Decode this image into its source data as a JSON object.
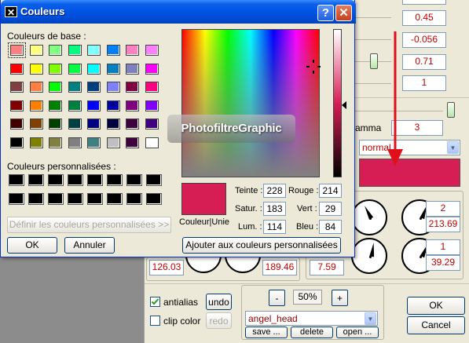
{
  "dialog": {
    "title": "Couleurs",
    "help_glyph": "?",
    "close_glyph": "✕",
    "base_colors_label": "Couleurs de base :",
    "custom_colors_label": "Couleurs personnalisées :",
    "define_custom_button": "Définir les couleurs personnalisées >>",
    "ok_button": "OK",
    "cancel_button": "Annuler",
    "add_custom_button": "Ajouter aux couleurs personnalisées",
    "color_solid_label": "Couleur|Unie",
    "watermark": "PhotofiltreGraphic",
    "fields": {
      "teinte_label": "Teinte :",
      "teinte": "228",
      "satur_label": "Satur. :",
      "satur": "183",
      "lum_label": "Lum. :",
      "lum": "114",
      "rouge_label": "Rouge :",
      "rouge": "214",
      "vert_label": "Vert :",
      "vert": "29",
      "bleu_label": "Bleu :",
      "bleu": "84"
    },
    "current_color": "#d61e54",
    "base_colors": [
      [
        "#ff8080",
        "#ffff80",
        "#80ff80",
        "#00ff80",
        "#80ffff",
        "#0080ff",
        "#ff80c0",
        "#ff80ff"
      ],
      [
        "#ff0000",
        "#ffff00",
        "#80ff00",
        "#00ff40",
        "#00ffff",
        "#0080c0",
        "#8080c0",
        "#ff00ff"
      ],
      [
        "#804040",
        "#ff8040",
        "#00ff00",
        "#008080",
        "#004080",
        "#8080ff",
        "#800040",
        "#ff0080"
      ],
      [
        "#800000",
        "#ff8000",
        "#008000",
        "#008040",
        "#0000ff",
        "#0000a0",
        "#800080",
        "#8000ff"
      ],
      [
        "#400000",
        "#804000",
        "#004000",
        "#004040",
        "#000080",
        "#000040",
        "#400040",
        "#400080"
      ],
      [
        "#000000",
        "#808000",
        "#808040",
        "#808080",
        "#408080",
        "#c0c0c0",
        "#400040",
        "#ffffff"
      ]
    ]
  },
  "background": {
    "values": [
      "0.45",
      "-0.056",
      "0.71",
      "1"
    ],
    "gamma_label": "amma",
    "gamma_value": "3",
    "blend_mode": "normal",
    "blend_color": "#d61e54",
    "dial_values": [
      "2",
      "213.69",
      "1",
      "39.29",
      "126.03",
      "189.46",
      "7.59"
    ],
    "antialias_label": "antialias",
    "undo_button": "undo",
    "clip_color_label": "clip color",
    "redo_button": "redo",
    "zoom_minus": "-",
    "zoom_value": "50%",
    "zoom_plus": "+",
    "shape_select": "angel_head",
    "save_button": "save ...",
    "delete_button": "delete",
    "open_button": "open ...",
    "ok_button": "OK",
    "cancel_button": "Cancel"
  },
  "accent_colors": {
    "arrow": "#e0101a",
    "titlebar": "#0054e3"
  }
}
